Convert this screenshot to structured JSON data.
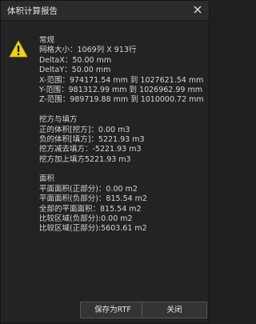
{
  "window": {
    "title": "体积计算报告"
  },
  "sections": {
    "general": {
      "heading": "常规",
      "lines": [
        "网格大小：1069列 X 913行",
        "DeltaX：50.00 mm",
        "DeltaY：50.00 mm",
        "X-范围：974171.54 mm 到 1027621.54 mm",
        "Y-范围：981312.99 mm 到 1026962.99 mm",
        "Z-范围：989719.88 mm 到 1010000.72 mm"
      ]
    },
    "cutfill": {
      "heading": "挖方与填方",
      "lines": [
        "正的体积[挖方]：0.00 m3",
        "负的体积[填方]：5221.93 m3",
        "挖方减去填方：-5221.93 m3",
        "挖方加上填方5221.93 m3"
      ]
    },
    "area": {
      "heading": "面积",
      "lines": [
        "平面面积(正部分)：0.00 m2",
        "平面面积(负部分)：815.54 m2",
        "全部的平面面积：815.54 m2",
        "比较区域(负部分):0.00 m2",
        "比较区域(正部分):5603.61 m2"
      ]
    }
  },
  "buttons": {
    "save_rtf": "保存为RTF",
    "close": "关闭"
  },
  "icons": {
    "warning": "warning-icon",
    "close": "close-icon"
  },
  "colors": {
    "warning_fill": "#f2d21a",
    "background": "#232323"
  }
}
